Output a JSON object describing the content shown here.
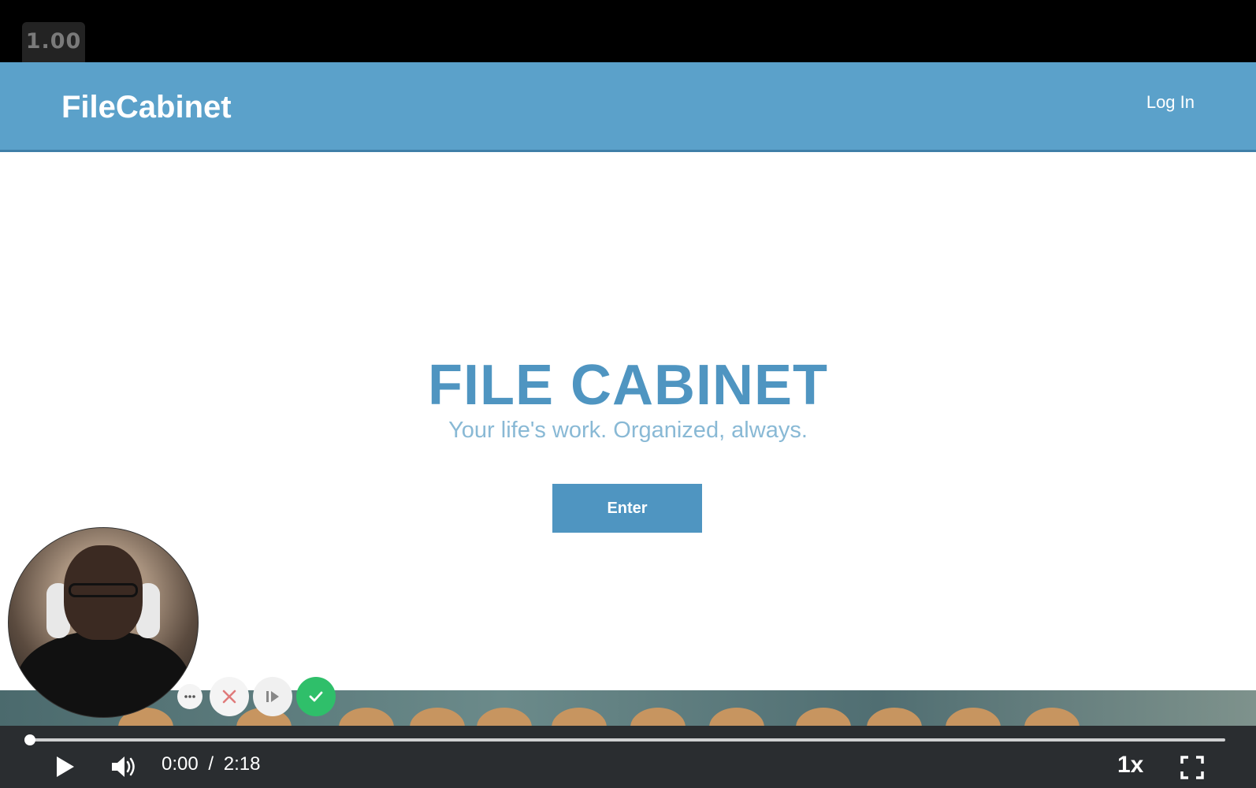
{
  "overlay": {
    "zoom_level": "1.00"
  },
  "site": {
    "brand": "FileCabinet",
    "login_link": "Log In",
    "hero_title": "FILE CABINET",
    "hero_subtitle": "Your life's work. Organized, always.",
    "enter_button": "Enter",
    "colors": {
      "header": "#5ba1ca",
      "accent": "#4f95c1"
    }
  },
  "recorder": {
    "buttons": [
      "more-options",
      "cancel",
      "resume",
      "done"
    ],
    "done_color": "#2fbf6a"
  },
  "player": {
    "current_time": "0:00",
    "separator": "/",
    "duration": "2:18",
    "speed": "1x",
    "progress_fraction": 0.0,
    "icons": [
      "play-icon",
      "volume-icon",
      "fullscreen-icon"
    ]
  }
}
